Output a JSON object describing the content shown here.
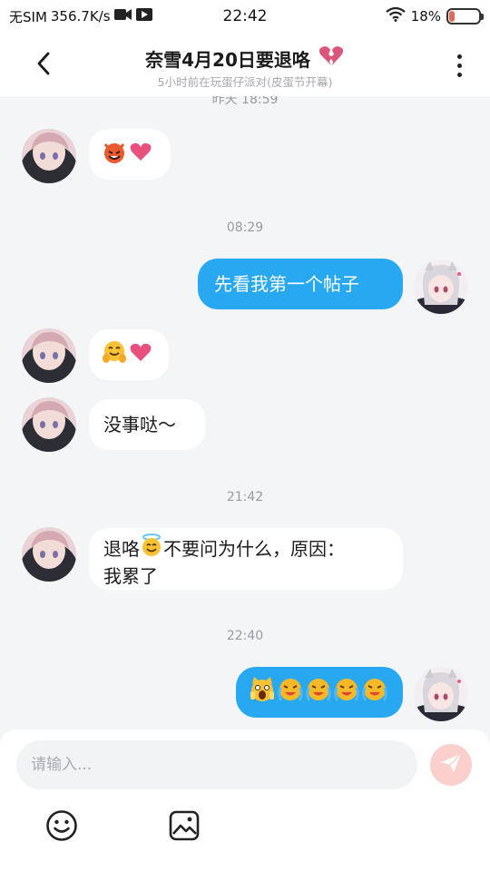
{
  "status_bar": {
    "carrier": "无SIM",
    "speed": "356.7K/s",
    "time": "22:42",
    "battery": "18%",
    "battery_level": 0.18,
    "battery_color": "#e06a55"
  },
  "header": {
    "title": "奈雪4月20日要退咯",
    "title_icon": "broken-heart-icon",
    "subtitle": "5小时前在玩蛋仔派对(皮蛋节开幕)",
    "back_icon": "chevron-left-icon",
    "more_icon": "more-vertical-icon"
  },
  "chat": {
    "timestamps": [
      "昨天 18:59",
      "08:29",
      "21:42",
      "22:40"
    ],
    "messages": [
      {
        "side": "in",
        "text": "",
        "emoji": [
          "smiling-devil-emoji",
          "pink-heart-emoji"
        ]
      },
      {
        "side": "out",
        "text": "先看我第一个帖子"
      },
      {
        "side": "in",
        "text": "",
        "emoji": [
          "hugging-face-emoji",
          "pink-heart-emoji"
        ]
      },
      {
        "side": "in",
        "text": "没事哒～"
      },
      {
        "side": "in",
        "text_part1": "退咯",
        "text_part2": "不要问为什么，原因：",
        "text_line2": "我累了",
        "emoji": [
          "halo-face-emoji"
        ]
      },
      {
        "side": "out",
        "text": "",
        "emoji": [
          "scream-cat-emoji",
          "crying-face-emoji",
          "crying-face-emoji",
          "crying-face-emoji",
          "crying-face-emoji"
        ]
      }
    ]
  },
  "composer": {
    "placeholder": "请输入...",
    "value": "",
    "send_icon": "send-icon",
    "emoji_icon": "smiley-icon",
    "image_icon": "image-icon"
  },
  "colors": {
    "outgoing_bubble": "#27a8f0",
    "incoming_bubble": "#ffffff",
    "background": "#f4f5f7",
    "send_button": "#fbd0cc"
  }
}
